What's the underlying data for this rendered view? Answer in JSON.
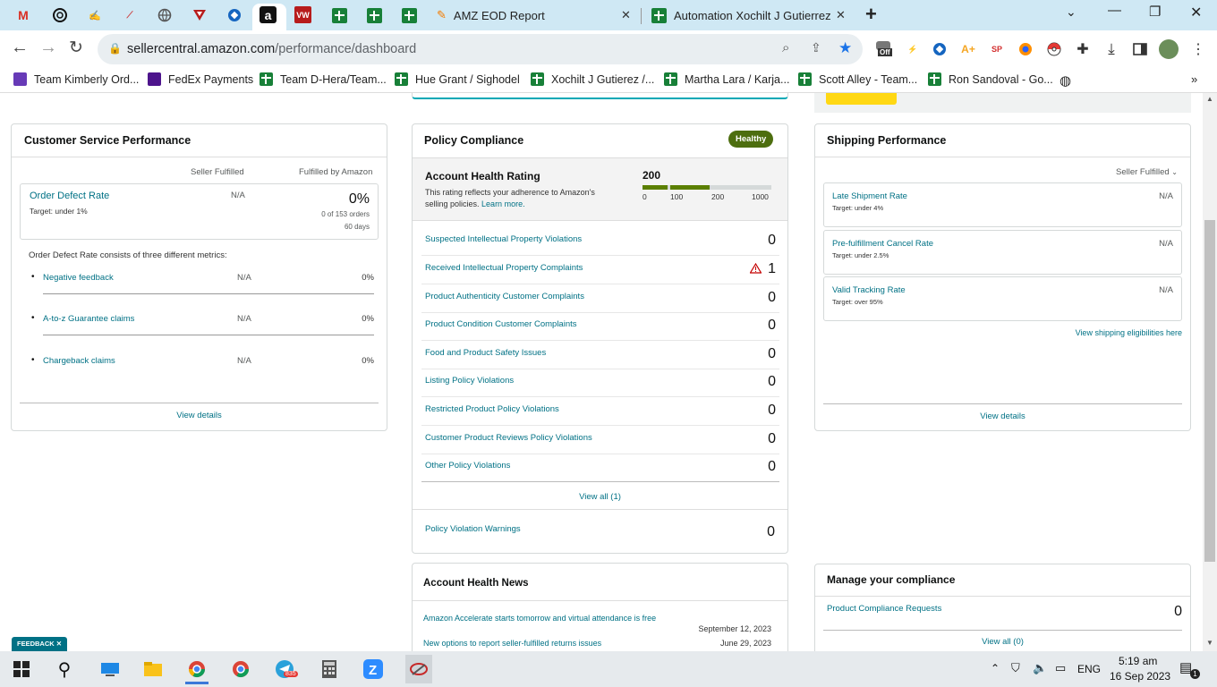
{
  "browser": {
    "tabs": [
      {
        "label": "AMZ EOD Report",
        "icon": "etsy-icon"
      },
      {
        "label": "Automation Xochilt J Gutierrez (C",
        "icon": "google-sheets-icon"
      }
    ],
    "url_domain": "sellercentral.amazon.com",
    "url_path": "/performance/dashboard",
    "ext_off_label": "Off"
  },
  "bookmarks": [
    {
      "label": "Team Kimberly Ord..."
    },
    {
      "label": "FedEx Payments"
    },
    {
      "label": "Team D-Hera/Team..."
    },
    {
      "label": "Hue Grant / Sighodel"
    },
    {
      "label": "Xochilt J Gutierez /..."
    },
    {
      "label": "Martha Lara / Karja..."
    },
    {
      "label": "Scott Alley - Team..."
    },
    {
      "label": "Ron Sandoval - Go..."
    }
  ],
  "csp": {
    "title": "Customer Service Performance",
    "col_seller": "Seller Fulfilled",
    "col_amazon": "Fulfilled by Amazon",
    "odr_label": "Order Defect Rate",
    "odr_target": "Target: under 1%",
    "odr_seller": "N/A",
    "odr_amazon": "0%",
    "odr_orders": "0 of 153 orders",
    "odr_days": "60 days",
    "metrics_intro": "Order Defect Rate consists of three different metrics:",
    "metrics": [
      {
        "label": "Negative feedback",
        "seller": "N/A",
        "amazon": "0%"
      },
      {
        "label": "A-to-z Guarantee claims",
        "seller": "N/A",
        "amazon": "0%"
      },
      {
        "label": "Chargeback claims",
        "seller": "N/A",
        "amazon": "0%"
      }
    ],
    "view_details": "View details"
  },
  "policy": {
    "title": "Policy Compliance",
    "badge": "Healthy",
    "ahr_title": "Account Health Rating",
    "ahr_desc": "This rating reflects your adherence to Amazon's selling policies.",
    "learn_more": "Learn more.",
    "ahr_value": "200",
    "ahr_ticks": [
      "0",
      "100",
      "200",
      "1000"
    ],
    "rows": [
      {
        "label": "Suspected Intellectual Property Violations",
        "count": "0"
      },
      {
        "label": "Received Intellectual Property Complaints",
        "count": "1"
      },
      {
        "label": "Product Authenticity Customer Complaints",
        "count": "0"
      },
      {
        "label": "Product Condition Customer Complaints",
        "count": "0"
      },
      {
        "label": "Food and Product Safety Issues",
        "count": "0"
      },
      {
        "label": "Listing Policy Violations",
        "count": "0"
      },
      {
        "label": "Restricted Product Policy Violations",
        "count": "0"
      },
      {
        "label": "Customer Product Reviews Policy Violations",
        "count": "0"
      },
      {
        "label": "Other Policy Violations",
        "count": "0"
      }
    ],
    "view_all": "View all (1)",
    "warnings_label": "Policy Violation Warnings",
    "warnings_count": "0",
    "colors": {
      "bar_fill": "#5b7f00",
      "badge": "#4d6e0f"
    }
  },
  "news": {
    "title": "Account Health News",
    "items": [
      {
        "text": "Amazon Accelerate starts tomorrow and virtual attendance is free",
        "date": "September 12, 2023"
      },
      {
        "text": "New options to report seller-fulfilled returns issues",
        "date": "June 29, 2023"
      }
    ]
  },
  "shipping": {
    "title": "Shipping Performance",
    "dropdown": "Seller Fulfilled",
    "metrics": [
      {
        "label": "Late Shipment Rate",
        "target": "Target: under 4%",
        "value": "N/A"
      },
      {
        "label": "Pre-fulfillment Cancel Rate",
        "target": "Target: under 2.5%",
        "value": "N/A"
      },
      {
        "label": "Valid Tracking Rate",
        "target": "Target: over 95%",
        "value": "N/A"
      }
    ],
    "eligibilities": "View shipping eligibilities here",
    "view_details": "View details"
  },
  "compliance": {
    "title": "Manage your compliance",
    "requests_label": "Product Compliance Requests",
    "requests_count": "0",
    "view_all": "View all (0)"
  },
  "feedback": "FEEDBACK",
  "taskbar": {
    "lang": "ENG",
    "time": "5:19 am",
    "date": "16 Sep 2023",
    "telegram_badge": "835",
    "notif_count": "1"
  }
}
